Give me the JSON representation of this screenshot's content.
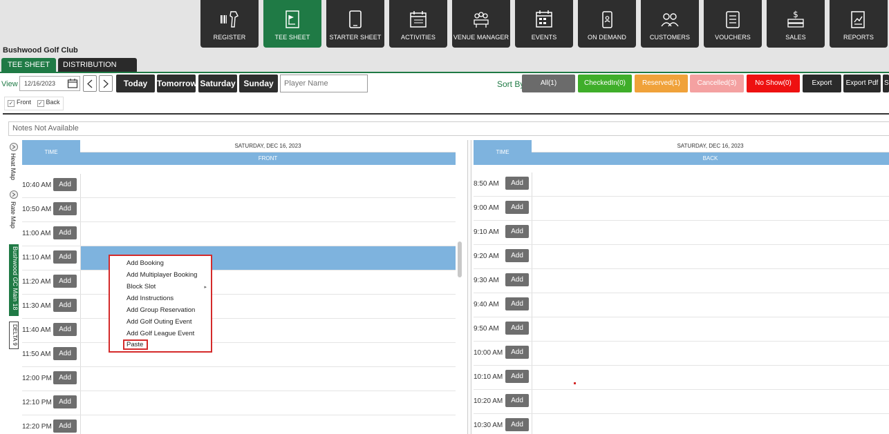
{
  "nav": [
    {
      "label": "REGISTER",
      "icon": "barcode-scanner-icon",
      "active": false
    },
    {
      "label": "TEE SHEET",
      "icon": "tee-sheet-icon",
      "active": true
    },
    {
      "label": "STARTER SHEET",
      "icon": "tablet-icon",
      "active": false
    },
    {
      "label": "ACTIVITIES",
      "icon": "calendar-list-icon",
      "active": false
    },
    {
      "label": "VENUE MANAGER",
      "icon": "venue-manager-icon",
      "active": false
    },
    {
      "label": "EVENTS",
      "icon": "events-calendar-icon",
      "active": false
    },
    {
      "label": "ON DEMAND",
      "icon": "mobile-phone-icon",
      "active": false
    },
    {
      "label": "CUSTOMERS",
      "icon": "customers-icon",
      "active": false
    },
    {
      "label": "VOUCHERS",
      "icon": "vouchers-icon",
      "active": false
    },
    {
      "label": "SALES",
      "icon": "sales-icon",
      "active": false
    },
    {
      "label": "REPORTS",
      "icon": "reports-icon",
      "active": false
    }
  ],
  "club_name": "Bushwood Golf Club",
  "tabs": [
    "TEE SHEET",
    "DISTRIBUTION ENGINE"
  ],
  "toolbar": {
    "view_label": "View",
    "date": "12/16/2023",
    "day_buttons": [
      "Today",
      "Tomorrow",
      "Saturday",
      "Sunday"
    ],
    "player_placeholder": "Player Name",
    "sort_label": "Sort By",
    "filters": [
      {
        "label": "All(1)",
        "color": "#6b6b6b"
      },
      {
        "label": "CheckedIn(0)",
        "color": "#3fae2a"
      },
      {
        "label": "Reserved(1)",
        "color": "#f0a23a"
      },
      {
        "label": "Cancelled(3)",
        "color": "#f4a1a1"
      },
      {
        "label": "No Show(0)",
        "color": "#ee1111"
      }
    ],
    "exports": [
      "Export Excel",
      "Export Pdf",
      "S"
    ]
  },
  "checks": {
    "front": "Front",
    "back": "Back"
  },
  "notes": "Notes Not Available",
  "side": {
    "heat_map": "Heat Map",
    "rate_map": "Rate Map",
    "course": "Bushwood GC  Main 18",
    "delta": "DELTA 9"
  },
  "front": {
    "time_header": "TIME",
    "date_header": "SATURDAY, DEC 16, 2023",
    "sub_header": "FRONT",
    "times": [
      "10:40 AM",
      "10:50 AM",
      "11:00 AM",
      "11:10 AM",
      "11:20 AM",
      "11:30 AM",
      "11:40 AM",
      "11:50 AM",
      "12:00 PM",
      "12:10 PM",
      "12:20 PM"
    ],
    "add_label": "Add"
  },
  "back": {
    "time_header": "TIME",
    "date_header": "SATURDAY, DEC 16, 2023",
    "sub_header": "BACK",
    "times": [
      "8:50 AM",
      "9:00 AM",
      "9:10 AM",
      "9:20 AM",
      "9:30 AM",
      "9:40 AM",
      "9:50 AM",
      "10:00 AM",
      "10:10 AM",
      "10:20 AM",
      "10:30 AM"
    ],
    "add_label": "Add"
  },
  "context_menu": {
    "items": [
      "Add Booking",
      "Add Multiplayer Booking",
      "Block Slot",
      "Add Instructions",
      "Add Group Reservation",
      "Add Golf Outing Event",
      "Add Golf League Event"
    ],
    "paste": "Paste"
  }
}
